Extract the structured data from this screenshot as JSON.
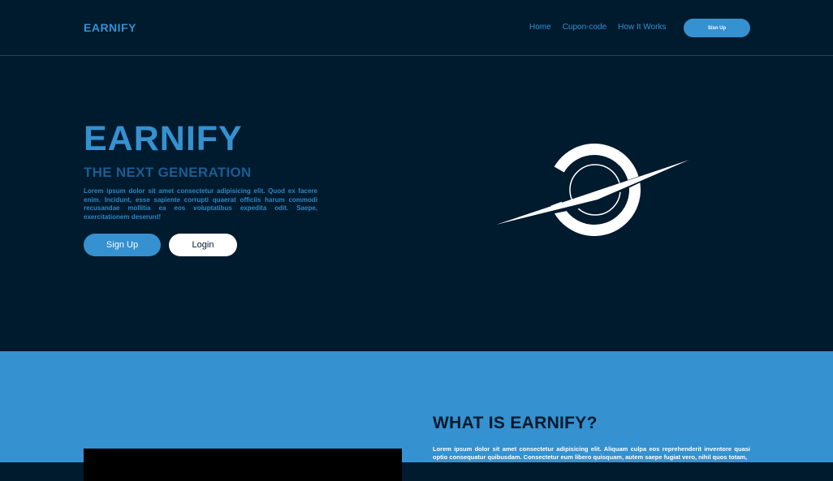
{
  "nav": {
    "brand": "EARNIFY",
    "links": [
      "Home",
      "Cupon-code",
      "How It Works"
    ],
    "signup_label": "Sisn Up"
  },
  "hero": {
    "title": "EARNIFY",
    "subtitle": "THE NEXT GENERATION",
    "text": "Lorem ipsum dolor sit amet consectetur adipisicing elit. Quod ex facere enim. Incidunt, esse sapiente corrupti quaerat officiis harum commodi recusandae mollitia ea eos voluptatibus expedita odit. Saepe, exercitationem deserunt!",
    "signup_label": "Sign Up",
    "login_label": "Login"
  },
  "about": {
    "title": "WHAT IS EARNIFY?",
    "text": "Lorem ipsum dolor sit amet consectetur adipisicing elit. Aliquam culpa eos reprehenderit inventore quasi optio consequatur quibusdam. Consectetur eum libero quisquam, autem saepe fugiat vero, nihil quos totam,"
  },
  "colors": {
    "background": "#001a2e",
    "accent": "#3591cf",
    "subtitle": "#1a5d91"
  }
}
